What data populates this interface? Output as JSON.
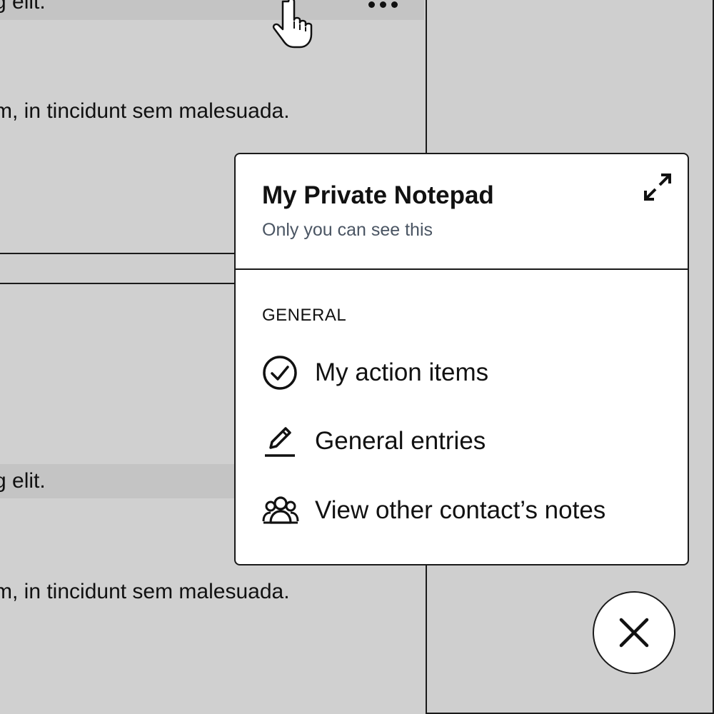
{
  "background": {
    "row_text_1": "g elit.",
    "row_text_2": "m, in tincidunt sem malesuada.",
    "row_text_3": "g elit.",
    "row_text_4": "m, in tincidunt sem malesuada.",
    "more_icon": "more-horizontal-icon",
    "cursor_icon": "hand-pointer-icon"
  },
  "popover": {
    "title": "My Private Notepad",
    "subtitle": "Only you can see this",
    "expand_icon": "expand-icon",
    "section_label": "GENERAL",
    "items": [
      {
        "label": "My action items",
        "icon": "check-circle-icon"
      },
      {
        "label": "General entries",
        "icon": "pencil-icon"
      },
      {
        "label": "View other contact’s notes",
        "icon": "group-icon"
      }
    ]
  },
  "close_button": {
    "icon": "close-icon"
  },
  "colors": {
    "background": "#cfcfcf",
    "surface": "#ffffff",
    "border": "#1a1a1a",
    "subtitle_text": "#4a5563"
  }
}
